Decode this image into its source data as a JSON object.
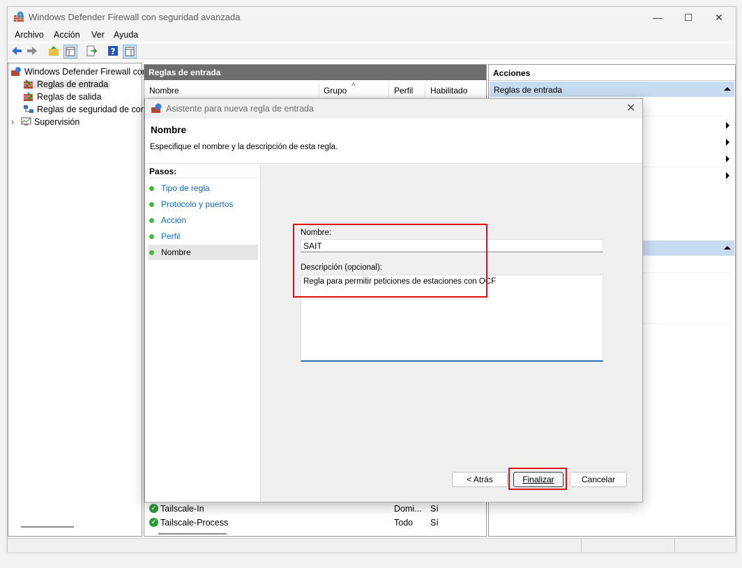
{
  "window": {
    "title": "Windows Defender Firewall con seguridad avanzada",
    "minimize_glyph": "—",
    "maximize_glyph": "☐",
    "close_glyph": "✕"
  },
  "menu": [
    "Archivo",
    "Acción",
    "Ver",
    "Ayuda"
  ],
  "toolbar": {
    "icons": [
      "back-icon",
      "forward-icon",
      "up-folder-icon",
      "show-hide-tree-icon",
      "export-list-icon",
      "help-icon",
      "properties-icon"
    ]
  },
  "tree": {
    "root": "Windows Defender Firewall con",
    "items": [
      {
        "label": "Reglas de entrada",
        "icon": "inbound-rules-icon",
        "selected": true
      },
      {
        "label": "Reglas de salida",
        "icon": "outbound-rules-icon",
        "selected": false
      },
      {
        "label": "Reglas de seguridad de con",
        "icon": "connection-security-icon",
        "selected": false
      },
      {
        "label": "Supervisión",
        "icon": "monitoring-icon",
        "selected": false
      }
    ]
  },
  "center": {
    "header": "Reglas de entrada",
    "columns": [
      "Nombre",
      "Grupo",
      "Perfil",
      "Habilitado"
    ],
    "rows": [
      {
        "name": "Tailscale-In",
        "profile": "Domi...",
        "enabled": "Sí"
      },
      {
        "name": "Tailscale-Process",
        "profile": "Todo",
        "enabled": "Sí"
      }
    ]
  },
  "actions": {
    "header": "Acciones",
    "section": "Reglas de entrada"
  },
  "dialog": {
    "title": "Asistente para nueva regla de entrada",
    "heading": "Nombre",
    "subheading": "Especifique el nombre y la descripción de esta regla.",
    "steps_label": "Pasos:",
    "steps": [
      {
        "label": "Tipo de regla",
        "current": false
      },
      {
        "label": "Protocolo y puertos",
        "current": false
      },
      {
        "label": "Acción",
        "current": false
      },
      {
        "label": "Perfil",
        "current": false
      },
      {
        "label": "Nombre",
        "current": true
      }
    ],
    "name_label": "Nombre:",
    "name_value": "SAIT",
    "desc_label": "Descripción (opcional):",
    "desc_value": "Regla para permitir peticiones de estaciones con OCF",
    "buttons": {
      "back": "< Atrás",
      "finish": "Finalizar",
      "cancel": "Cancelar"
    }
  },
  "colors": {
    "highlight": "#e01010",
    "step_dot": "#3fb93f",
    "link": "#1466b8",
    "selection": "#c7dcf1"
  }
}
